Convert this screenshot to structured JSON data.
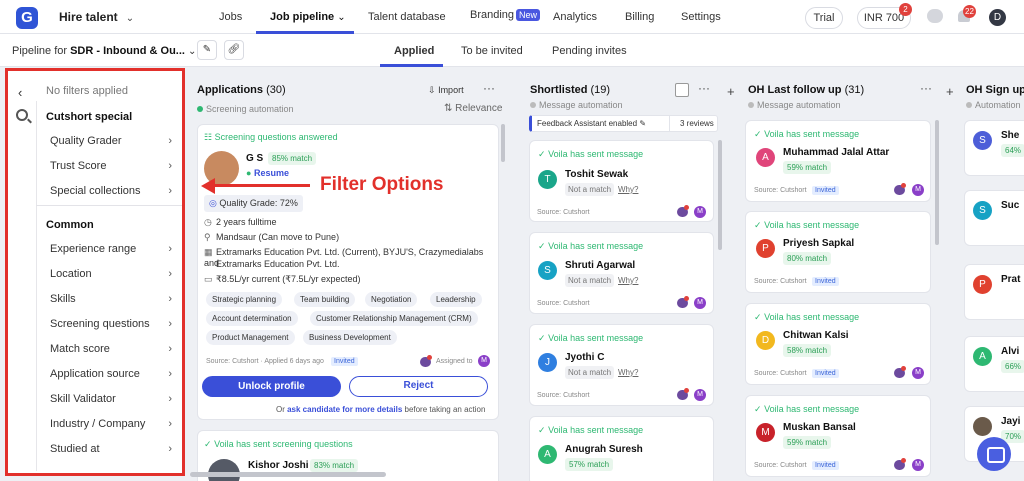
{
  "brand": {
    "logo": "G",
    "hire_talent": "Hire talent"
  },
  "nav": {
    "jobs": "Jobs",
    "job_pipeline": "Job pipeline",
    "talent_database": "Talent database",
    "branding": "Branding",
    "branding_badge": "New",
    "analytics": "Analytics",
    "billing": "Billing",
    "settings": "Settings"
  },
  "topright": {
    "trial": "Trial",
    "credits": "INR 700",
    "credits_badge": "2",
    "notif_badge": "22",
    "user_initial": "D"
  },
  "subbar": {
    "pipeline_prefix": "Pipeline for ",
    "pipeline_name": "SDR - Inbound & Ou...",
    "tabs": [
      "Applied",
      "To be invited",
      "Pending invites"
    ]
  },
  "filter": {
    "no_filters": "No filters applied",
    "section_special": "Cutshort special",
    "special_items": [
      "Quality Grader",
      "Trust Score",
      "Special collections"
    ],
    "section_common": "Common",
    "common_items": [
      "Experience range",
      "Location",
      "Skills",
      "Screening questions",
      "Match score",
      "Application source",
      "Skill Validator",
      "Industry / Company",
      "Studied at"
    ]
  },
  "annotation": "Filter Options",
  "applications": {
    "title": "Applications",
    "count": "(30)",
    "import": "Import",
    "sub": "Screening automation",
    "relevance": "Relevance",
    "card1": {
      "screen": "Screening questions answered",
      "name": "G S",
      "match": "85% match",
      "resume": "Resume",
      "quality": "Quality Grade: 72%",
      "exp": "2 years fulltime",
      "loc": "Mandsaur  (Can move to Pune)",
      "company1": "Extramarks Education Pvt. Ltd. (Current), BYJU'S, Crazymedialabs and",
      "company2": "Extramarks Education Pvt. Ltd.",
      "salary": "₹8.5L/yr current  (₹7.5L/yr expected)",
      "skills": [
        "Strategic planning",
        "Team building",
        "Negotiation",
        "Leadership",
        "Account determination",
        "Customer Relationship Management (CRM)",
        "Product Management",
        "Business Development"
      ],
      "source": "Source: Cutshort  ·  Applied 6 days ago",
      "invited": "Invited",
      "assigned": "Assigned to",
      "assigned_initial": "M",
      "unlock": "Unlock profile",
      "reject": "Reject",
      "or_prefix": "Or ",
      "ask_link": "ask candidate for more details",
      "or_suffix": " before taking an action"
    },
    "card2": {
      "screen": "Voila has sent screening questions",
      "name": "Kishor Joshi",
      "match": "83% match"
    }
  },
  "shortlisted": {
    "title": "Shortlisted",
    "count": "(19)",
    "sub": "Message automation",
    "feedback": "Feedback Assistant enabled",
    "reviews": "3 reviews",
    "msg": "Voila has sent message",
    "not_match": "Not a match",
    "why": "Why?",
    "source": "Source: Cutshort",
    "candidates": [
      {
        "initial": "T",
        "name": "Toshit Sewak",
        "color": "#1aa68a"
      },
      {
        "initial": "S",
        "name": "Shruti Agarwal",
        "color": "#17a2c4"
      },
      {
        "initial": "J",
        "name": "Jyothi C",
        "color": "#2f7fe0"
      },
      {
        "initial": "A",
        "name": "Anugrah Suresh",
        "color": "#2eb872",
        "match": "57% match"
      }
    ]
  },
  "oh_last": {
    "title": "OH Last follow up",
    "count": "(31)",
    "sub": "Message automation",
    "msg": "Voila has sent message",
    "source": "Source: Cutshort",
    "invited": "Invited",
    "candidates": [
      {
        "initial": "A",
        "name": "Muhammad Jalal Attar",
        "match": "59% match",
        "color": "#e0457a"
      },
      {
        "initial": "P",
        "name": "Priyesh Sapkal",
        "match": "80% match",
        "color": "#e0412f"
      },
      {
        "initial": "D",
        "name": "Chitwan Kalsi",
        "match": "58% match",
        "color": "#f2b81e"
      },
      {
        "initial": "M",
        "name": "Muskan Bansal",
        "match": "59% match",
        "color": "#c8222a"
      }
    ]
  },
  "oh_signup": {
    "title": "OH Sign up",
    "sub": "Automation",
    "candidates": [
      {
        "initial": "S",
        "name": "She",
        "match": "64%",
        "color": "#4d5ed8"
      },
      {
        "initial": "S",
        "name": "Suc",
        "match": "",
        "color": "#17a2c4"
      },
      {
        "initial": "P",
        "name": "Prat",
        "match": "",
        "color": "#e0412f"
      },
      {
        "initial": "A",
        "name": "Alvi",
        "match": "66%",
        "color": "#2eb872"
      },
      {
        "initial": "",
        "name": "Jayi",
        "match": "70%",
        "color": "#6a5a4a"
      }
    ]
  }
}
